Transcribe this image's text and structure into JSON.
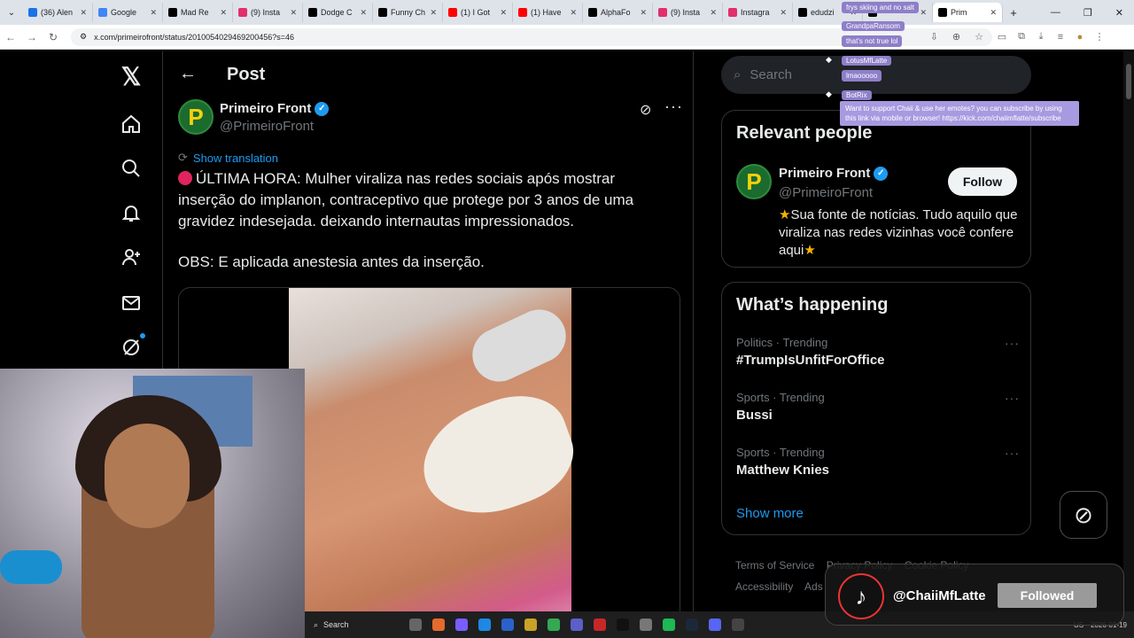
{
  "browser": {
    "tabs": [
      {
        "label": "(36) Alen",
        "color": "#1a73e8"
      },
      {
        "label": "Google",
        "color": "#4285f4"
      },
      {
        "label": "Mad Re",
        "color": "#000000"
      },
      {
        "label": "(9) Insta",
        "color": "#e1306c"
      },
      {
        "label": "Dodge C",
        "color": "#000000"
      },
      {
        "label": "Funny Ch",
        "color": "#000000"
      },
      {
        "label": "(1) I Got",
        "color": "#ff0000"
      },
      {
        "label": "(1) Have",
        "color": "#ff0000"
      },
      {
        "label": "AlphaFo",
        "color": "#000000"
      },
      {
        "label": "(9) Insta",
        "color": "#e1306c"
      },
      {
        "label": "Instagra",
        "color": "#e1306c"
      },
      {
        "label": "edudzi",
        "color": "#000000"
      },
      {
        "label": "",
        "color": "#000000"
      },
      {
        "label": "Prim",
        "color": "#000000",
        "active": true
      }
    ],
    "url": "x.com/primeirofront/status/2010054029469200456?s=46"
  },
  "post": {
    "header": "Post",
    "author_name": "Primeiro Front",
    "author_handle": "@PrimeiroFront",
    "avatar_letter": "P",
    "show_translation": "Show translation",
    "text": "ÚLTIMA HORA: Mulher viraliza nas redes sociais após mostrar inserção do implanon, contraceptivo que protege por 3 anos de uma gravidez indesejada. deixando internautas impressionados.",
    "obs": "OBS: E aplicada anestesia antes da inserção."
  },
  "sidebar": {
    "search_placeholder": "Search",
    "relevant_title": "Relevant people",
    "person_name": "Primeiro Front",
    "person_handle": "@PrimeiroFront",
    "follow_label": "Follow",
    "bio": "Sua fonte de notícias. Tudo aquilo que viraliza nas redes vizinhas você confere aqui",
    "happening_title": "What’s happening",
    "trends": [
      {
        "category": "Politics · Trending",
        "name": "#TrumpIsUnfitForOffice"
      },
      {
        "category": "Sports · Trending",
        "name": "Bussi"
      },
      {
        "category": "Sports · Trending",
        "name": "Matthew Knies"
      }
    ],
    "show_more": "Show more",
    "footer": {
      "terms": "Terms of Service",
      "privacy": "Privacy Policy",
      "cookie": "Cookie Policy",
      "accessibility": "Accessibility",
      "ads": "Ads"
    }
  },
  "chat": {
    "messages": [
      {
        "user": "",
        "text": "frys skiing and no salt"
      },
      {
        "user": "GrandpaRansom",
        "text": "that's not true lol"
      },
      {
        "user": "LotusMfLatte",
        "text": "lmaooooo"
      },
      {
        "user": "BotRix",
        "text": "Want to support Chaii & use her emotes? you can subscribe by using this link via mobile or browser! https://kick.com/chaiimflatte/subscribe"
      }
    ]
  },
  "tiktok": {
    "username": "@ChaiiMfLatte",
    "followed_label": "Followed"
  },
  "taskbar": {
    "search_label": "Search",
    "date": "2026-01-19",
    "lang": "US"
  },
  "colors": {
    "accent": "#1d9bf0",
    "background": "#000000",
    "text": "#e7e9ea",
    "muted": "#71767b"
  }
}
